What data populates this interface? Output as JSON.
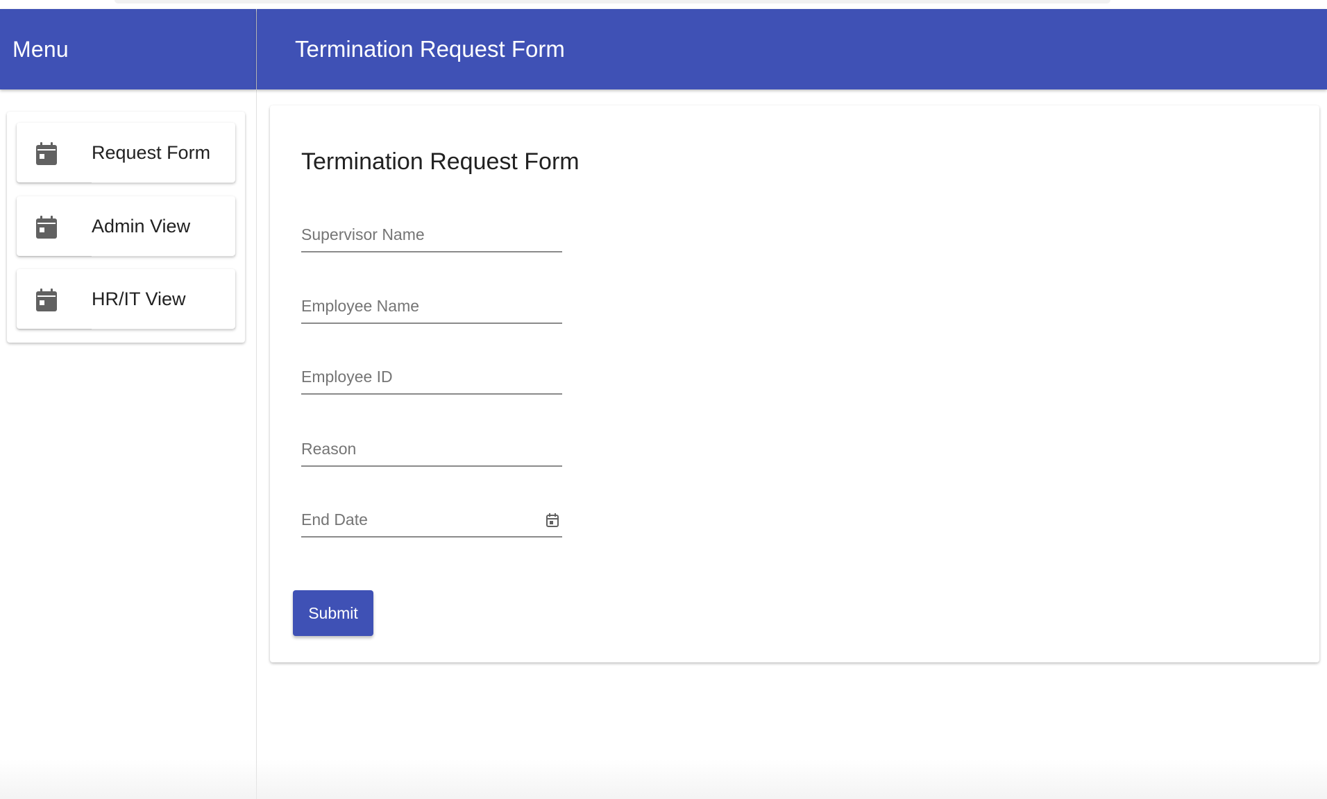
{
  "sidebar": {
    "title": "Menu",
    "items": [
      {
        "label": "Request Form",
        "icon": "calendar-icon"
      },
      {
        "label": "Admin View",
        "icon": "calendar-icon"
      },
      {
        "label": "HR/IT View",
        "icon": "calendar-icon"
      }
    ]
  },
  "header": {
    "title": "Termination Request Form"
  },
  "form": {
    "heading": "Termination Request Form",
    "fields": {
      "supervisor_name": {
        "placeholder": "Supervisor Name",
        "value": ""
      },
      "employee_name": {
        "placeholder": "Employee Name",
        "value": ""
      },
      "employee_id": {
        "placeholder": "Employee ID",
        "value": ""
      },
      "reason": {
        "placeholder": "Reason",
        "value": ""
      },
      "end_date": {
        "placeholder": "End Date",
        "value": "",
        "icon": "calendar-icon"
      }
    },
    "submit_label": "Submit"
  },
  "colors": {
    "primary": "#3f51b5",
    "icon_gray": "#616161"
  }
}
